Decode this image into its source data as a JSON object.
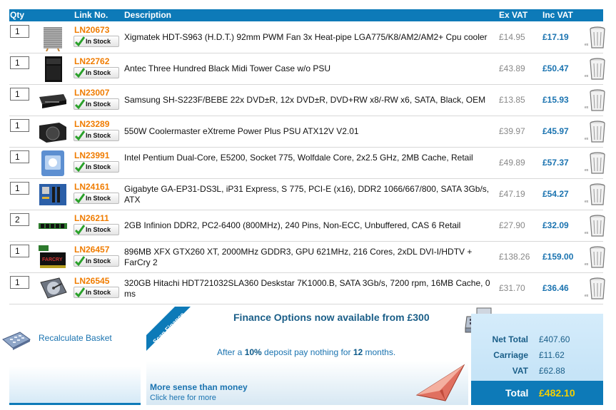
{
  "columns": {
    "qty": "Qty",
    "link": "Link No.",
    "desc": "Description",
    "exvat": "Ex VAT",
    "incvat": "Inc VAT"
  },
  "stock_label": "In Stock",
  "items": [
    {
      "qty": "1",
      "link": "LN20673",
      "desc": "Xigmatek HDT-S963 (H.D.T.) 92mm PWM Fan 3x Heat-pipe LGA775/K8/AM2/AM2+ Cpu cooler",
      "exvat": "£14.95",
      "incvat": "£17.19",
      "thumb": "cpu-cooler"
    },
    {
      "qty": "1",
      "link": "LN22762",
      "desc": "Antec Three Hundred Black Midi Tower Case w/o PSU",
      "exvat": "£43.89",
      "incvat": "£50.47",
      "thumb": "tower-case"
    },
    {
      "qty": "1",
      "link": "LN23007",
      "desc": "Samsung SH-S223F/BEBE 22x DVD±R, 12x DVD±R, DVD+RW x8/-RW x6, SATA, Black, OEM",
      "exvat": "£13.85",
      "incvat": "£15.93",
      "thumb": "dvd-drive"
    },
    {
      "qty": "1",
      "link": "LN23289",
      "desc": "550W Coolermaster eXtreme Power Plus PSU ATX12V V2.01",
      "exvat": "£39.97",
      "incvat": "£45.97",
      "thumb": "psu"
    },
    {
      "qty": "1",
      "link": "LN23991",
      "desc": "Intel Pentium Dual-Core, E5200, Socket 775, Wolfdale Core, 2x2.5 GHz, 2MB Cache, Retail",
      "exvat": "£49.89",
      "incvat": "£57.37",
      "thumb": "cpu-box"
    },
    {
      "qty": "1",
      "link": "LN24161",
      "desc": "Gigabyte GA-EP31-DS3L, iP31 Express, S 775, PCI-E (x16), DDR2 1066/667/800, SATA 3Gb/s, ATX",
      "exvat": "£47.19",
      "incvat": "£54.27",
      "thumb": "motherboard"
    },
    {
      "qty": "2",
      "link": "LN26211",
      "desc": "2GB Infinion DDR2, PC2-6400 (800MHz), 240 Pins, Non-ECC, Unbuffered, CAS 6 Retail",
      "exvat": "£27.90",
      "incvat": "£32.09",
      "thumb": "ram"
    },
    {
      "qty": "1",
      "link": "LN26457",
      "desc": "896MB XFX GTX260 XT, 2000MHz GDDR3, GPU 621MHz, 216 Cores, 2xDL DVI-I/HDTV + FarCry 2",
      "exvat": "£138.26",
      "incvat": "£159.00",
      "thumb": "graphics-card"
    },
    {
      "qty": "1",
      "link": "LN26545",
      "desc": "320GB Hitachi HDT721032SLA360 Deskstar 7K1000.B, SATA 3Gb/s, 7200 rpm, 16MB Cache, 0 ms",
      "exvat": "£31.70",
      "incvat": "£36.46",
      "thumb": "hard-drive"
    }
  ],
  "recalc_label": "Recalculate Basket",
  "finance": {
    "ribbon": "Scan Finance",
    "title": "Finance Options now available from £300",
    "text_pre": "After a ",
    "text_pct": "10%",
    "text_mid": " deposit pay nothing for ",
    "text_months": "12",
    "text_post": " months.",
    "more": "More sense than money",
    "click": "Click here for more"
  },
  "totals": {
    "net_label": "Net Total",
    "net": "£407.60",
    "carriage_label": "Carriage",
    "carriage": "£11.62",
    "vat_label": "VAT",
    "vat": "£62.88",
    "total_label": "Total",
    "total": "£482.10"
  },
  "colors": {
    "header": "#0d7ab8",
    "link": "#f07c00",
    "price": "#1a73b0",
    "total": "#f5d000"
  }
}
